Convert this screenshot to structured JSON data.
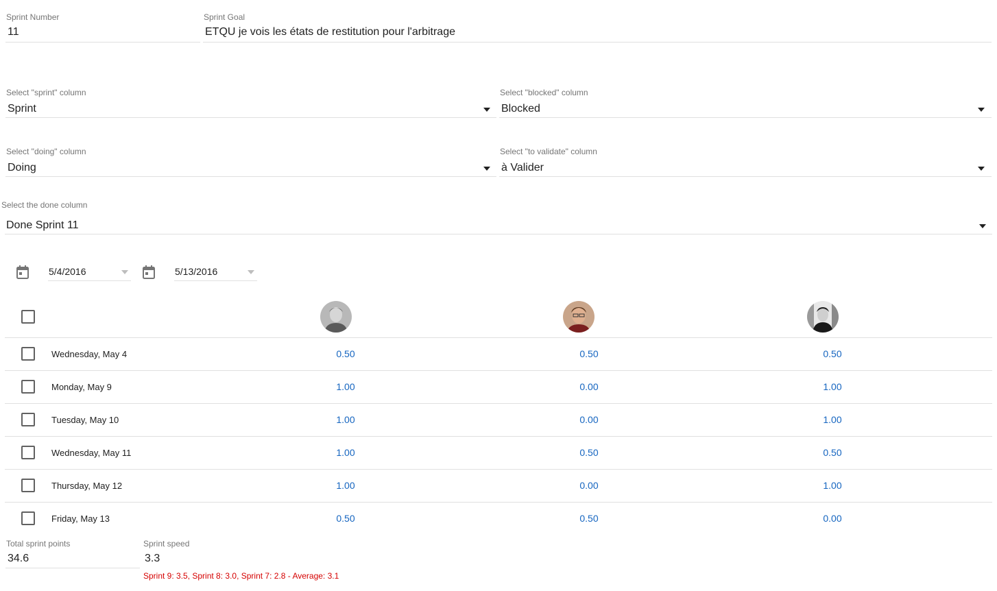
{
  "sprint": {
    "number_label": "Sprint Number",
    "number_value": "11",
    "goal_label": "Sprint Goal",
    "goal_value": "ETQU je vois les états de restitution pour l'arbitrage"
  },
  "columns": {
    "sprint_label": "Select \"sprint\" column",
    "sprint_value": "Sprint",
    "blocked_label": "Select \"blocked\" column",
    "blocked_value": "Blocked",
    "doing_label": "Select \"doing\" column",
    "doing_value": "Doing",
    "validate_label": "Select \"to validate\" column",
    "validate_value": "à Valider",
    "done_label": "Select the done column",
    "done_value": "Done Sprint 11"
  },
  "dates": {
    "start": "5/4/2016",
    "end": "5/13/2016"
  },
  "table": {
    "members": [
      "member-1-avatar",
      "member-2-avatar",
      "member-3-avatar"
    ],
    "rows": [
      {
        "day": "Wednesday, May 4",
        "values": [
          "0.50",
          "0.50",
          "0.50"
        ]
      },
      {
        "day": "Monday, May 9",
        "values": [
          "1.00",
          "0.00",
          "1.00"
        ]
      },
      {
        "day": "Tuesday, May 10",
        "values": [
          "1.00",
          "0.00",
          "1.00"
        ]
      },
      {
        "day": "Wednesday, May 11",
        "values": [
          "1.00",
          "0.50",
          "0.50"
        ]
      },
      {
        "day": "Thursday, May 12",
        "values": [
          "1.00",
          "0.00",
          "1.00"
        ]
      },
      {
        "day": "Friday, May 13",
        "values": [
          "0.50",
          "0.50",
          "0.00"
        ]
      }
    ]
  },
  "summary": {
    "total_label": "Total sprint points",
    "total_value": "34.6",
    "speed_label": "Sprint speed",
    "speed_value": "3.3",
    "speed_hint": "Sprint 9: 3.5, Sprint 8: 3.0, Sprint 7: 2.8  - Average: 3.1"
  },
  "colors": {
    "accent_value": "#1565c0",
    "error_hint": "#d50000"
  }
}
